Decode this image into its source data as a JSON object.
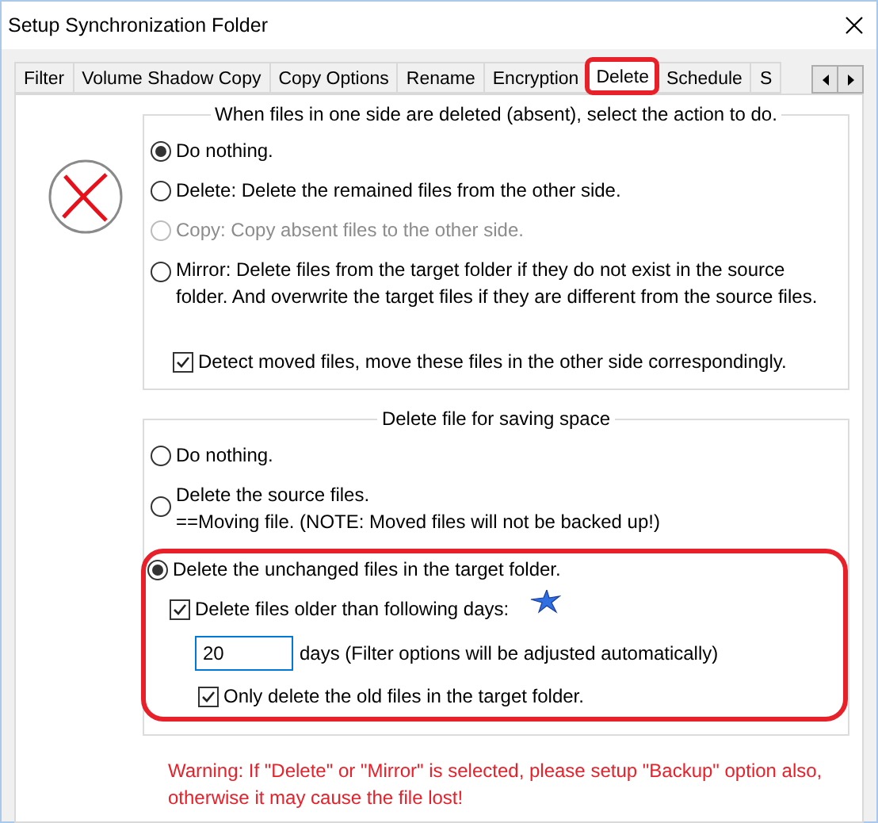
{
  "window": {
    "title": "Setup Synchronization Folder"
  },
  "tabs": [
    {
      "label": "Filter",
      "selected": false,
      "highlighted": false
    },
    {
      "label": "Volume Shadow Copy",
      "selected": false,
      "highlighted": false
    },
    {
      "label": "Copy Options",
      "selected": false,
      "highlighted": false
    },
    {
      "label": "Rename",
      "selected": false,
      "highlighted": false
    },
    {
      "label": "Encryption",
      "selected": false,
      "highlighted": false
    },
    {
      "label": "Delete",
      "selected": true,
      "highlighted": true
    },
    {
      "label": "Schedule",
      "selected": false,
      "highlighted": false
    },
    {
      "label": "S",
      "selected": false,
      "highlighted": false
    }
  ],
  "delete_action": {
    "title": "When files in one side are deleted (absent), select the action to do.",
    "options": [
      {
        "label": "Do nothing.",
        "selected": true,
        "disabled": false
      },
      {
        "label": "Delete: Delete the remained files from the other side.",
        "selected": false,
        "disabled": false
      },
      {
        "label": "Copy: Copy absent files to the other side.",
        "selected": false,
        "disabled": true
      },
      {
        "label": "Mirror: Delete files from the target folder if they do not exist in the source folder. And overwrite the target files if they are different from the source files.",
        "selected": false,
        "disabled": false
      }
    ],
    "detect_moved": {
      "label": "Detect moved files, move these files in the other side correspondingly.",
      "checked": true
    }
  },
  "saving_space": {
    "title": "Delete file for saving space",
    "options": [
      {
        "label": "Do nothing.",
        "selected": false,
        "highlighted": false
      },
      {
        "label": "Delete the source files.\n==Moving file. (NOTE: Moved files will not be backed up!)",
        "selected": false,
        "highlighted": false
      },
      {
        "label": "Delete the unchanged files in the target folder.",
        "selected": true,
        "highlighted": true
      }
    ],
    "older_than": {
      "label": "Delete files older than following days:",
      "checked": true
    },
    "days": {
      "value": "20",
      "label": "days (Filter options will be adjusted automatically)"
    },
    "only_target": {
      "label": "Only delete the old files in the target folder.",
      "checked": true
    }
  },
  "warning": "Warning: If \"Delete\" or \"Mirror\" is selected, please setup \"Backup\" option also, otherwise it may cause the file lost!"
}
